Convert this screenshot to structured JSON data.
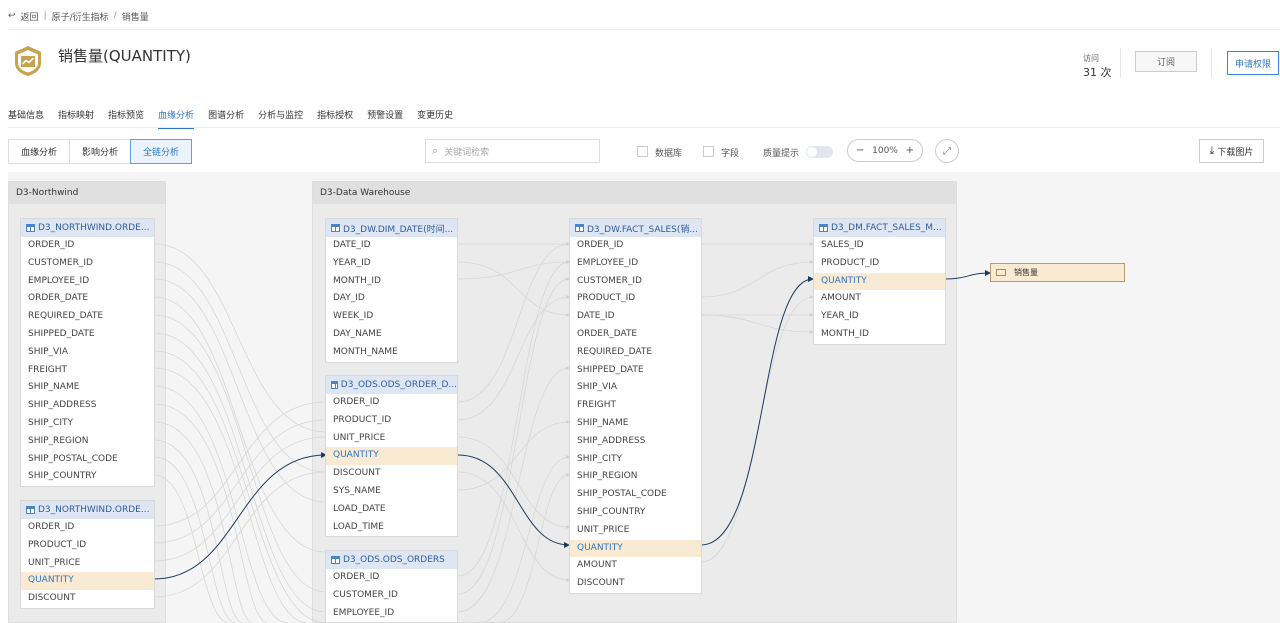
{
  "breadcrumb": {
    "back": "返回",
    "sep": "|",
    "path1": "原子/衍生指标",
    "slash": "/",
    "current": "销售量"
  },
  "title": "销售量(QUANTITY)",
  "visits": {
    "label": "访问",
    "value": "31 次"
  },
  "buttons": {
    "subscribe": "订阅",
    "apply": "申请权限"
  },
  "tabs": [
    {
      "label": "基础信息",
      "active": false
    },
    {
      "label": "指标映射",
      "active": false
    },
    {
      "label": "指标预览",
      "active": false
    },
    {
      "label": "血缘分析",
      "active": true
    },
    {
      "label": "图谱分析",
      "active": false
    },
    {
      "label": "分析与监控",
      "active": false
    },
    {
      "label": "指标授权",
      "active": false
    },
    {
      "label": "预警设置",
      "active": false
    },
    {
      "label": "变更历史",
      "active": false
    }
  ],
  "segments": [
    {
      "label": "血缘分析",
      "active": false
    },
    {
      "label": "影响分析",
      "active": false
    },
    {
      "label": "全链分析",
      "active": true
    }
  ],
  "search": {
    "placeholder": "关键词检索"
  },
  "filters": {
    "database": "数据库",
    "field": "字段",
    "quality": "质量提示"
  },
  "zoom": {
    "minus": "−",
    "value": "100%",
    "plus": "+"
  },
  "download": "下载图片",
  "groups": {
    "northwind": "D3-Northwind",
    "warehouse": "D3-Data Warehouse"
  },
  "tables": {
    "nw_orders": {
      "title": "D3_NORTHWIND.ORDE...",
      "fields": [
        "ORDER_ID",
        "CUSTOMER_ID",
        "EMPLOYEE_ID",
        "ORDER_DATE",
        "REQUIRED_DATE",
        "SHIPPED_DATE",
        "SHIP_VIA",
        "FREIGHT",
        "SHIP_NAME",
        "SHIP_ADDRESS",
        "SHIP_CITY",
        "SHIP_REGION",
        "SHIP_POSTAL_CODE",
        "SHIP_COUNTRY"
      ]
    },
    "nw_details": {
      "title": "D3_NORTHWIND.ORDE...",
      "fields": [
        "ORDER_ID",
        "PRODUCT_ID",
        "UNIT_PRICE",
        "QUANTITY",
        "DISCOUNT"
      ]
    },
    "dim_date": {
      "title": "D3_DW.DIM_DATE(时间...",
      "fields": [
        "DATE_ID",
        "YEAR_ID",
        "MONTH_ID",
        "DAY_ID",
        "WEEK_ID",
        "DAY_NAME",
        "MONTH_NAME"
      ]
    },
    "ods_detail": {
      "title": "D3_ODS.ODS_ORDER_D...",
      "fields": [
        "ORDER_ID",
        "PRODUCT_ID",
        "UNIT_PRICE",
        "QUANTITY",
        "DISCOUNT",
        "SYS_NAME",
        "LOAD_DATE",
        "LOAD_TIME"
      ]
    },
    "ods_orders": {
      "title": "D3_ODS.ODS_ORDERS",
      "fields": [
        "ORDER_ID",
        "CUSTOMER_ID",
        "EMPLOYEE_ID"
      ]
    },
    "fact_sales": {
      "title": "D3_DW.FACT_SALES(销...",
      "fields": [
        "ORDER_ID",
        "EMPLOYEE_ID",
        "CUSTOMER_ID",
        "PRODUCT_ID",
        "DATE_ID",
        "ORDER_DATE",
        "REQUIRED_DATE",
        "SHIPPED_DATE",
        "SHIP_VIA",
        "FREIGHT",
        "SHIP_NAME",
        "SHIP_ADDRESS",
        "SHIP_CITY",
        "SHIP_REGION",
        "SHIP_POSTAL_CODE",
        "SHIP_COUNTRY",
        "UNIT_PRICE",
        "QUANTITY",
        "AMOUNT",
        "DISCOUNT"
      ]
    },
    "dm_sales": {
      "title": "D3_DM.FACT_SALES_M...",
      "fields": [
        "SALES_ID",
        "PRODUCT_ID",
        "QUANTITY",
        "AMOUNT",
        "YEAR_ID",
        "MONTH_ID"
      ]
    }
  },
  "target": {
    "label": "销售量"
  },
  "colors": {
    "accent": "#2f76c6",
    "highlight": "#f9ead4",
    "logo": "#c9a24f"
  }
}
